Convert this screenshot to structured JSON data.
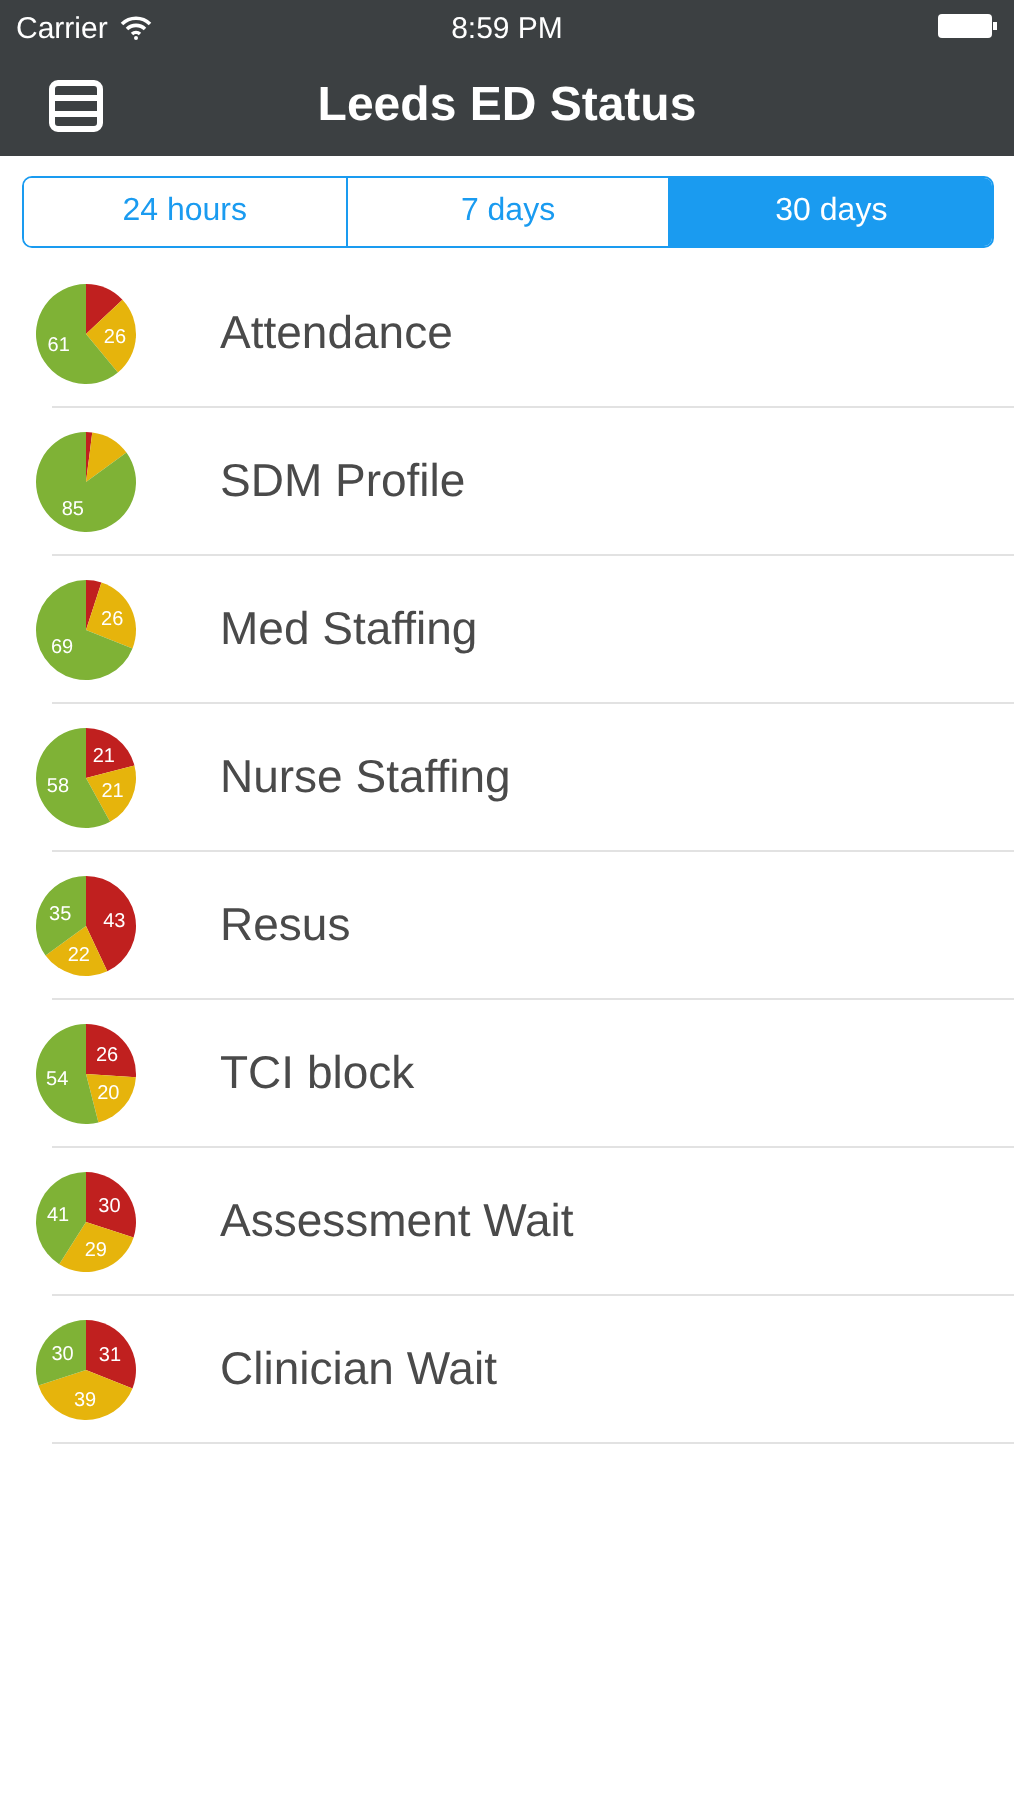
{
  "status_bar": {
    "carrier": "Carrier",
    "time": "8:59 PM"
  },
  "nav": {
    "title": "Leeds ED Status"
  },
  "tabs": [
    {
      "label": "24 hours",
      "selected": false
    },
    {
      "label": "7 days",
      "selected": false
    },
    {
      "label": "30 days",
      "selected": true
    }
  ],
  "rows": [
    {
      "label": "Attendance",
      "chart_data": {
        "type": "pie",
        "values": [
          13,
          26,
          61
        ],
        "colors": [
          "#c0201f",
          "#e6b40c",
          "#7fb236"
        ],
        "value_labels": [
          null,
          "26",
          "61"
        ]
      }
    },
    {
      "label": "SDM Profile",
      "chart_data": {
        "type": "pie",
        "values": [
          2,
          13,
          85
        ],
        "colors": [
          "#c0201f",
          "#e6b40c",
          "#7fb236"
        ],
        "value_labels": [
          null,
          null,
          "85"
        ]
      }
    },
    {
      "label": "Med Staffing",
      "chart_data": {
        "type": "pie",
        "values": [
          5,
          26,
          69
        ],
        "colors": [
          "#c0201f",
          "#e6b40c",
          "#7fb236"
        ],
        "value_labels": [
          null,
          "26",
          "69"
        ]
      }
    },
    {
      "label": "Nurse Staffing",
      "chart_data": {
        "type": "pie",
        "values": [
          21,
          21,
          58
        ],
        "colors": [
          "#c0201f",
          "#e6b40c",
          "#7fb236"
        ],
        "value_labels": [
          "21",
          "21",
          "58"
        ]
      }
    },
    {
      "label": "Resus",
      "chart_data": {
        "type": "pie",
        "values": [
          43,
          22,
          35
        ],
        "colors": [
          "#c0201f",
          "#e6b40c",
          "#7fb236"
        ],
        "value_labels": [
          "43",
          "22",
          "35"
        ]
      }
    },
    {
      "label": "TCI block",
      "chart_data": {
        "type": "pie",
        "values": [
          26,
          20,
          54
        ],
        "colors": [
          "#c0201f",
          "#e6b40c",
          "#7fb236"
        ],
        "value_labels": [
          "26",
          "20",
          "54"
        ]
      }
    },
    {
      "label": "Assessment Wait",
      "chart_data": {
        "type": "pie",
        "values": [
          30,
          29,
          41
        ],
        "colors": [
          "#c0201f",
          "#e6b40c",
          "#7fb236"
        ],
        "value_labels": [
          "30",
          "29",
          "41"
        ]
      }
    },
    {
      "label": "Clinician Wait",
      "chart_data": {
        "type": "pie",
        "values": [
          31,
          39,
          30
        ],
        "colors": [
          "#c0201f",
          "#e6b40c",
          "#7fb236"
        ],
        "value_labels": [
          "31",
          "39",
          "30"
        ]
      }
    }
  ]
}
